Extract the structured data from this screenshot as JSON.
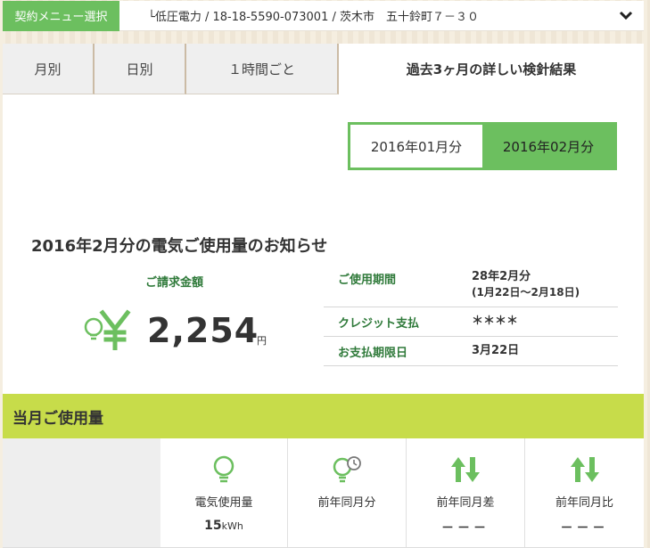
{
  "contract": {
    "menu_label": "契約メニュー選択",
    "info": "└低圧電力 / 18-18-5590-073001 / 茨木市　五十鈴町７－３０"
  },
  "tabs": [
    {
      "label": "月別"
    },
    {
      "label": "日別"
    },
    {
      "label": "１時間ごと"
    },
    {
      "label": "過去3ヶ月の詳しい検針結果"
    }
  ],
  "month_toggle": {
    "option_1": "2016年01月分",
    "option_2": "2016年02月分",
    "selected": "2016年02月分"
  },
  "notice": {
    "title": "2016年2月分の電気ご使用量のお知らせ",
    "billing_label": "ご請求金額",
    "amount": "2,254",
    "amount_unit": "円"
  },
  "info_table": {
    "period_key": "ご使用期間",
    "period_value": "28年2月分",
    "period_range": "(1月22日～2月18日)",
    "payment_key": "クレジット支払",
    "payment_value": "＊＊＊＊",
    "due_key": "お支払期限日",
    "due_value": "3月22日"
  },
  "usage": {
    "section_title": "当月ご使用量",
    "cells": [
      {
        "label": "電気使用量",
        "value": "15",
        "unit": "kWh",
        "icon": "bulb-icon"
      },
      {
        "label": "前年同月分",
        "value": "",
        "icon": "bulb-clock-icon"
      },
      {
        "label": "前年同月差",
        "value": "－－－",
        "icon": "up-down-arrows-icon"
      },
      {
        "label": "前年同月比",
        "value": "－－－",
        "icon": "up-down-arrows-icon"
      }
    ]
  },
  "colors": {
    "accent_green": "#6cbf5f",
    "lime_bar": "#c7dc4a",
    "label_green": "#2f7a3a"
  }
}
